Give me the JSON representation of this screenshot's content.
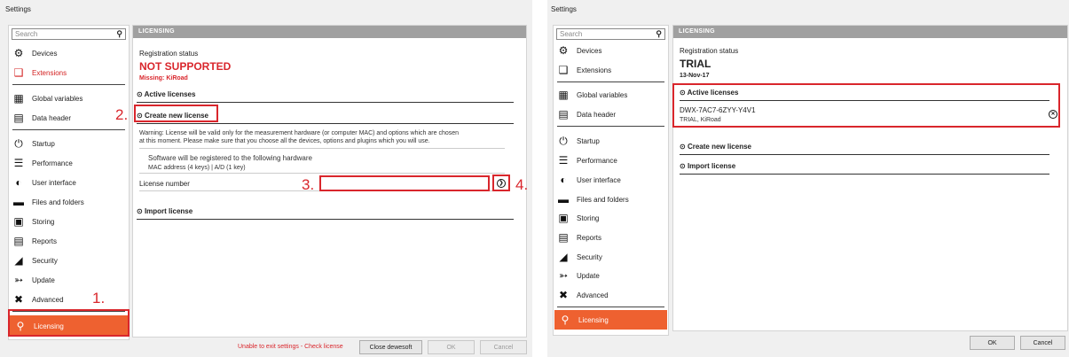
{
  "left": {
    "title": "Settings",
    "search_placeholder": "Search",
    "sidebar": [
      {
        "label": "Devices",
        "icon": "gear-icon"
      },
      {
        "label": "Extensions",
        "icon": "cube-icon"
      },
      {
        "label": "Global variables",
        "icon": "calendar-icon"
      },
      {
        "label": "Data header",
        "icon": "database-icon"
      },
      {
        "label": "Startup",
        "icon": "power-icon"
      },
      {
        "label": "Performance",
        "icon": "sliders-icon"
      },
      {
        "label": "User interface",
        "icon": "gauge-icon"
      },
      {
        "label": "Files and folders",
        "icon": "folder-icon"
      },
      {
        "label": "Storing",
        "icon": "save-icon"
      },
      {
        "label": "Reports",
        "icon": "report-icon"
      },
      {
        "label": "Security",
        "icon": "lock-icon"
      },
      {
        "label": "Update",
        "icon": "update-icon"
      },
      {
        "label": "Advanced",
        "icon": "tools-icon"
      },
      {
        "label": "Licensing",
        "icon": "key-icon"
      }
    ],
    "header": "LICENSING",
    "registration_label": "Registration status",
    "status": "NOT SUPPORTED",
    "missing": "Missing: KiRoad",
    "active_licenses": "Active licenses",
    "create_new_license": "Create new license",
    "warning_text_1": "Warning: License will be valid only for the measurement hardware (or computer MAC) and options which are chosen",
    "warning_text_2": "at this moment. Please make sure that you choose all the devices, options and plugins which you will use.",
    "hw_text": "Software will be registered to the following hardware",
    "hw_sub": "MAC address (4 keys) | A/D (1 key)",
    "license_number_label": "License number",
    "import_license": "Import license",
    "exit_warning": "Unable to exit settings - Check license",
    "close_button": "Close dewesoft",
    "ok_button": "OK",
    "cancel_button": "Cancel",
    "annotations": {
      "a1": "1.",
      "a2": "2.",
      "a3": "3.",
      "a4": "4."
    }
  },
  "right": {
    "title": "Settings",
    "search_placeholder": "Search",
    "sidebar": [
      {
        "label": "Devices",
        "icon": "gear-icon"
      },
      {
        "label": "Extensions",
        "icon": "cube-icon"
      },
      {
        "label": "Global variables",
        "icon": "calendar-icon"
      },
      {
        "label": "Data header",
        "icon": "database-icon"
      },
      {
        "label": "Startup",
        "icon": "power-icon"
      },
      {
        "label": "Performance",
        "icon": "sliders-icon"
      },
      {
        "label": "User interface",
        "icon": "gauge-icon"
      },
      {
        "label": "Files and folders",
        "icon": "folder-icon"
      },
      {
        "label": "Storing",
        "icon": "save-icon"
      },
      {
        "label": "Reports",
        "icon": "report-icon"
      },
      {
        "label": "Security",
        "icon": "lock-icon"
      },
      {
        "label": "Update",
        "icon": "update-icon"
      },
      {
        "label": "Advanced",
        "icon": "tools-icon"
      },
      {
        "label": "Licensing",
        "icon": "key-icon"
      }
    ],
    "header": "LICENSING",
    "registration_label": "Registration status",
    "status": "TRIAL",
    "date": "13-Nov-17",
    "active_licenses": "Active licenses",
    "license_key": "DWX-7AC7-6ZYY-Y4V1",
    "license_sub": "TRIAL, KiRoad",
    "create_new_license": "Create new license",
    "import_license": "Import license",
    "ok_button": "OK",
    "cancel_button": "Cancel"
  },
  "colors": {
    "accent": "#ee6130",
    "alert": "#d9262c",
    "header": "#a0a0a0"
  }
}
